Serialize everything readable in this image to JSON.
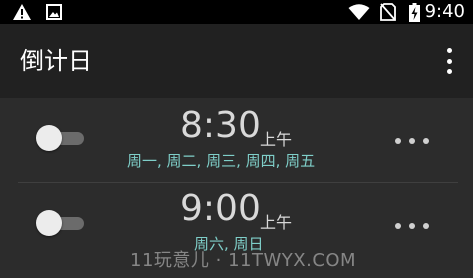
{
  "status_bar": {
    "time": "9:40",
    "icons": [
      "warning-icon",
      "image-icon",
      "wifi-icon",
      "no-sim-icon",
      "battery-charging-icon"
    ]
  },
  "app_bar": {
    "title": "倒计日",
    "menu_icon": "more-vert-icon"
  },
  "alarms": [
    {
      "time": "8:30",
      "ampm": "上午",
      "days": "周一, 周二, 周三, 周四, 周五",
      "enabled": false
    },
    {
      "time": "9:00",
      "ampm": "上午",
      "days": "周六, 周日",
      "enabled": false
    }
  ],
  "watermark": "11玩意儿 · 11TWYX.COM",
  "colors": {
    "background": "#2c2c2c",
    "app_bar": "#212121",
    "status_bar": "#000000",
    "days_text": "#7fcfc9",
    "time_text": "#d9d9d9"
  }
}
